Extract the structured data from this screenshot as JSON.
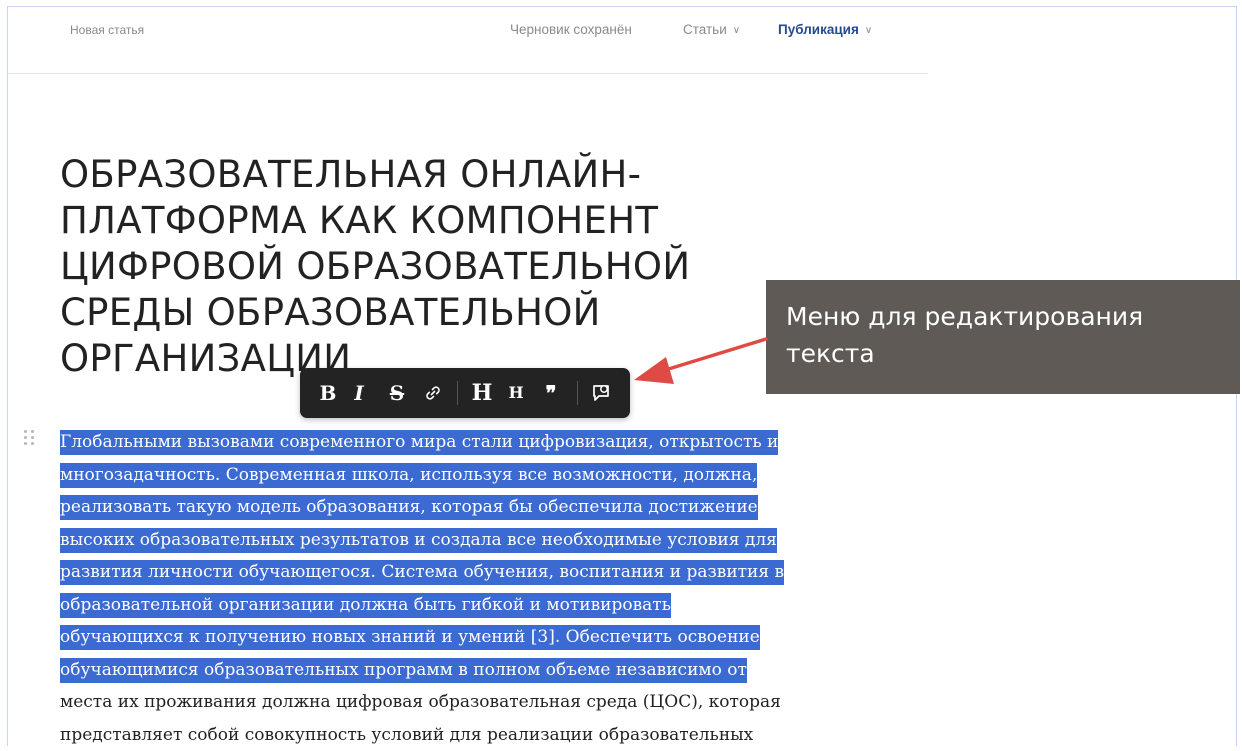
{
  "header": {
    "doc_title": "Новая статья",
    "draft_status": "Черновик сохранён",
    "articles_menu": "Статьи",
    "publish_menu": "Публикация"
  },
  "article": {
    "title_lines": [
      "ОБРАЗОВАТЕЛЬНАЯ ОНЛАЙН-",
      "ПЛАТФОРМА КАК КОМПОНЕНТ",
      "ЦИФРОВОЙ ОБРАЗОВАТЕЛЬНОЙ",
      "СРЕДЫ ОБРАЗОВАТЕЛЬНОЙ",
      "ОРГАНИЗАЦИИ"
    ],
    "body_lines": [
      "Глобальными вызовами современного мира стали цифровизация, открытость и",
      "многозадачность. Современная школа, используя все возможности, должна,",
      "реализовать такую модель образования, которая бы обеспечила достижение",
      "высоких образовательных результатов и создала все необходимые условия для",
      "развития личности обучающегося. Система обучения, воспитания и развития в",
      "образовательной организации должна быть гибкой и мотивировать",
      "обучающихся к получению новых знаний и умений [3]. Обеспечить освоение",
      "обучающимися образовательных программ в полном объеме независимо от",
      "места их проживания должна цифровая образовательная среда (ЦОС), которая",
      "представляет собой совокупность условий для реализации образовательных"
    ],
    "selected_line_count": 8
  },
  "toolbar": {
    "bold": "B",
    "italic": "I",
    "strike": "S",
    "heading_large": "H",
    "heading_small": "H",
    "quote": "❞"
  },
  "annotation": {
    "label": "Меню для редактирования текста",
    "color": "#5f5a55",
    "arrow_color": "#e04a45"
  },
  "colors": {
    "selection": "#3b6ad3",
    "publish_link": "#274a8f"
  }
}
